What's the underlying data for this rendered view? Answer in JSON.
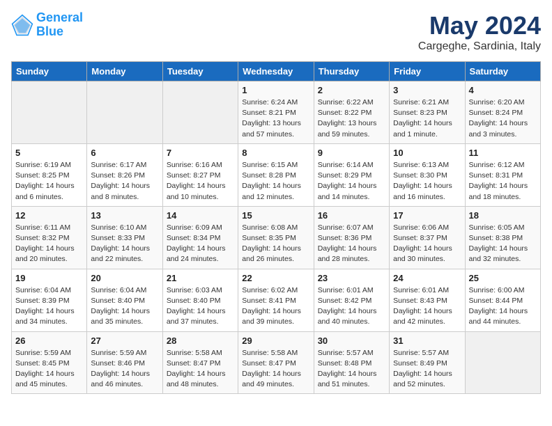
{
  "header": {
    "logo_line1": "General",
    "logo_line2": "Blue",
    "title": "May 2024",
    "subtitle": "Cargeghe, Sardinia, Italy"
  },
  "weekdays": [
    "Sunday",
    "Monday",
    "Tuesday",
    "Wednesday",
    "Thursday",
    "Friday",
    "Saturday"
  ],
  "weeks": [
    [
      {
        "day": "",
        "info": ""
      },
      {
        "day": "",
        "info": ""
      },
      {
        "day": "",
        "info": ""
      },
      {
        "day": "1",
        "info": "Sunrise: 6:24 AM\nSunset: 8:21 PM\nDaylight: 13 hours\nand 57 minutes."
      },
      {
        "day": "2",
        "info": "Sunrise: 6:22 AM\nSunset: 8:22 PM\nDaylight: 13 hours\nand 59 minutes."
      },
      {
        "day": "3",
        "info": "Sunrise: 6:21 AM\nSunset: 8:23 PM\nDaylight: 14 hours\nand 1 minute."
      },
      {
        "day": "4",
        "info": "Sunrise: 6:20 AM\nSunset: 8:24 PM\nDaylight: 14 hours\nand 3 minutes."
      }
    ],
    [
      {
        "day": "5",
        "info": "Sunrise: 6:19 AM\nSunset: 8:25 PM\nDaylight: 14 hours\nand 6 minutes."
      },
      {
        "day": "6",
        "info": "Sunrise: 6:17 AM\nSunset: 8:26 PM\nDaylight: 14 hours\nand 8 minutes."
      },
      {
        "day": "7",
        "info": "Sunrise: 6:16 AM\nSunset: 8:27 PM\nDaylight: 14 hours\nand 10 minutes."
      },
      {
        "day": "8",
        "info": "Sunrise: 6:15 AM\nSunset: 8:28 PM\nDaylight: 14 hours\nand 12 minutes."
      },
      {
        "day": "9",
        "info": "Sunrise: 6:14 AM\nSunset: 8:29 PM\nDaylight: 14 hours\nand 14 minutes."
      },
      {
        "day": "10",
        "info": "Sunrise: 6:13 AM\nSunset: 8:30 PM\nDaylight: 14 hours\nand 16 minutes."
      },
      {
        "day": "11",
        "info": "Sunrise: 6:12 AM\nSunset: 8:31 PM\nDaylight: 14 hours\nand 18 minutes."
      }
    ],
    [
      {
        "day": "12",
        "info": "Sunrise: 6:11 AM\nSunset: 8:32 PM\nDaylight: 14 hours\nand 20 minutes."
      },
      {
        "day": "13",
        "info": "Sunrise: 6:10 AM\nSunset: 8:33 PM\nDaylight: 14 hours\nand 22 minutes."
      },
      {
        "day": "14",
        "info": "Sunrise: 6:09 AM\nSunset: 8:34 PM\nDaylight: 14 hours\nand 24 minutes."
      },
      {
        "day": "15",
        "info": "Sunrise: 6:08 AM\nSunset: 8:35 PM\nDaylight: 14 hours\nand 26 minutes."
      },
      {
        "day": "16",
        "info": "Sunrise: 6:07 AM\nSunset: 8:36 PM\nDaylight: 14 hours\nand 28 minutes."
      },
      {
        "day": "17",
        "info": "Sunrise: 6:06 AM\nSunset: 8:37 PM\nDaylight: 14 hours\nand 30 minutes."
      },
      {
        "day": "18",
        "info": "Sunrise: 6:05 AM\nSunset: 8:38 PM\nDaylight: 14 hours\nand 32 minutes."
      }
    ],
    [
      {
        "day": "19",
        "info": "Sunrise: 6:04 AM\nSunset: 8:39 PM\nDaylight: 14 hours\nand 34 minutes."
      },
      {
        "day": "20",
        "info": "Sunrise: 6:04 AM\nSunset: 8:40 PM\nDaylight: 14 hours\nand 35 minutes."
      },
      {
        "day": "21",
        "info": "Sunrise: 6:03 AM\nSunset: 8:40 PM\nDaylight: 14 hours\nand 37 minutes."
      },
      {
        "day": "22",
        "info": "Sunrise: 6:02 AM\nSunset: 8:41 PM\nDaylight: 14 hours\nand 39 minutes."
      },
      {
        "day": "23",
        "info": "Sunrise: 6:01 AM\nSunset: 8:42 PM\nDaylight: 14 hours\nand 40 minutes."
      },
      {
        "day": "24",
        "info": "Sunrise: 6:01 AM\nSunset: 8:43 PM\nDaylight: 14 hours\nand 42 minutes."
      },
      {
        "day": "25",
        "info": "Sunrise: 6:00 AM\nSunset: 8:44 PM\nDaylight: 14 hours\nand 44 minutes."
      }
    ],
    [
      {
        "day": "26",
        "info": "Sunrise: 5:59 AM\nSunset: 8:45 PM\nDaylight: 14 hours\nand 45 minutes."
      },
      {
        "day": "27",
        "info": "Sunrise: 5:59 AM\nSunset: 8:46 PM\nDaylight: 14 hours\nand 46 minutes."
      },
      {
        "day": "28",
        "info": "Sunrise: 5:58 AM\nSunset: 8:47 PM\nDaylight: 14 hours\nand 48 minutes."
      },
      {
        "day": "29",
        "info": "Sunrise: 5:58 AM\nSunset: 8:47 PM\nDaylight: 14 hours\nand 49 minutes."
      },
      {
        "day": "30",
        "info": "Sunrise: 5:57 AM\nSunset: 8:48 PM\nDaylight: 14 hours\nand 51 minutes."
      },
      {
        "day": "31",
        "info": "Sunrise: 5:57 AM\nSunset: 8:49 PM\nDaylight: 14 hours\nand 52 minutes."
      },
      {
        "day": "",
        "info": ""
      }
    ]
  ]
}
